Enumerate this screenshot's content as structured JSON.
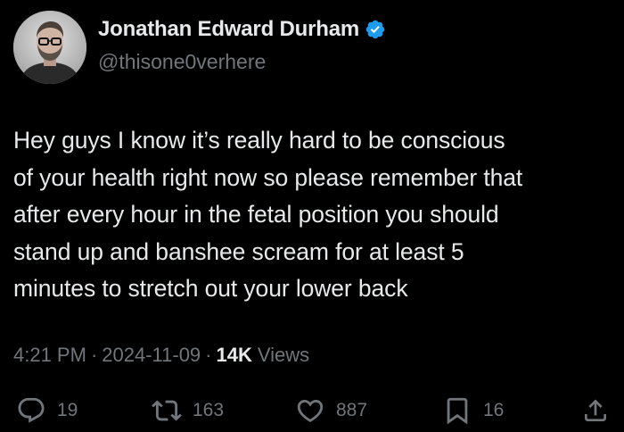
{
  "author": {
    "display_name": "Jonathan Edward Durham",
    "handle": "@thisone0verhere",
    "verified": true,
    "avatar_icon": "profile-photo"
  },
  "tweet": {
    "text": "Hey guys I know it’s really hard to be conscious\nof your health right now so please remember that\nafter every hour in the fetal position you should\nstand up and banshee scream for at least 5\nminutes to stretch out your lower back",
    "time": "4:21 PM",
    "separator": "·",
    "date": "2024-11-09",
    "views_count": "14K",
    "views_label": "Views"
  },
  "actions": {
    "reply": {
      "icon": "reply-icon",
      "count": "19"
    },
    "retweet": {
      "icon": "retweet-icon",
      "count": "163"
    },
    "like": {
      "icon": "heart-icon",
      "count": "887"
    },
    "bookmark": {
      "icon": "bookmark-icon",
      "count": "16"
    },
    "share": {
      "icon": "share-icon"
    }
  },
  "colors": {
    "background": "#000000",
    "primary_text": "#e7e9ea",
    "secondary_text": "#71767b",
    "verified_badge": "#1d9bf0"
  }
}
